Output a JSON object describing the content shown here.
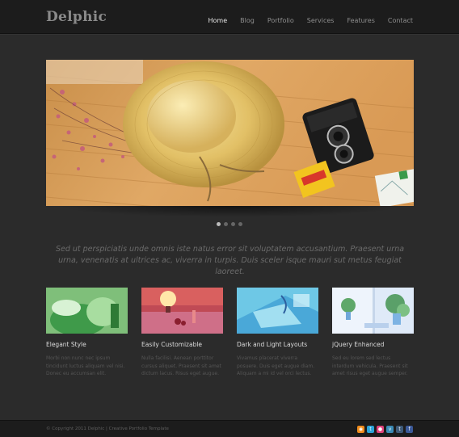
{
  "site": {
    "logo": "Delphic"
  },
  "nav": [
    {
      "label": "Home",
      "active": true
    },
    {
      "label": "Blog",
      "active": false
    },
    {
      "label": "Portfolio",
      "active": false
    },
    {
      "label": "Services",
      "active": false
    },
    {
      "label": "Features",
      "active": false
    },
    {
      "label": "Contact",
      "active": false
    }
  ],
  "slider": {
    "dots": 4,
    "active_dot": 1
  },
  "tagline": "Sed ut perspiciatis unde omnis iste natus error sit voluptatem accusantium. Praesent urna urna, venenatis at ultrices ac, viverra in turpis. Duis sceler isque mauri sut metus feugiat laoreet.",
  "features": [
    {
      "title": "Elegant Style",
      "text": "Morbi non nunc nec ipsum tincidunt luctus aliquam vel nisi. Donec eu accumsan elit."
    },
    {
      "title": "Easily Customizable",
      "text": "Nulla facilisi. Aenean porttitor cursus aliquet. Praesent sit amet dictum lacus. Risus eget augue."
    },
    {
      "title": "Dark and Light Layouts",
      "text": "Vivamus placerat viverra posuere. Duis eget augue diam. Aliquam a mi id vel orci lectus."
    },
    {
      "title": "jQuery Enhanced",
      "text": "Sed eu lorem sed lectus interdum vehicula. Praesent sit amet risus eget augue semper."
    }
  ],
  "footer": {
    "copyright": "© Copyright 2011 Delphic | Creative Portfolio Template"
  },
  "social_icons": [
    "rss-icon",
    "twitter-icon",
    "flickr-icon",
    "vimeo-icon",
    "tumblr-icon",
    "facebook-icon"
  ],
  "colors": {
    "background": "#2b2b2b",
    "header": "#1c1c1c",
    "nav_active": "#e6e6e6",
    "nav": "#8e8e8e"
  }
}
